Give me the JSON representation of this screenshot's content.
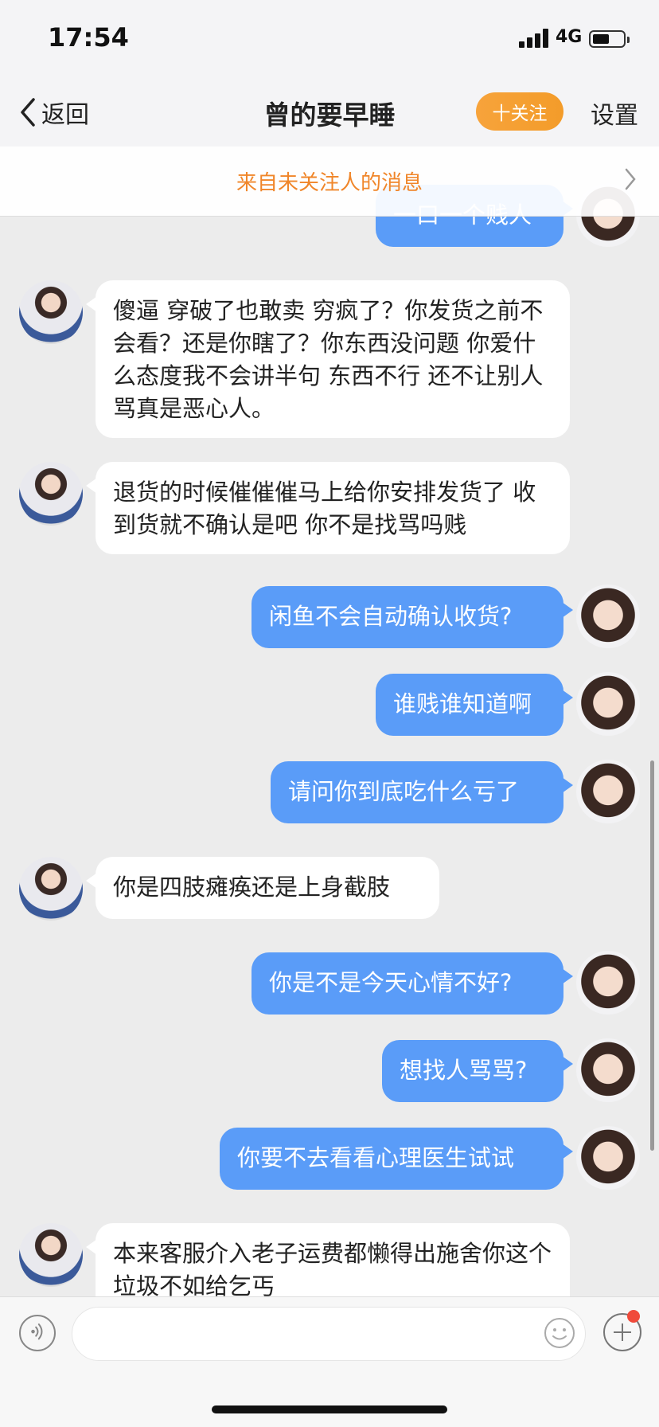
{
  "status": {
    "time": "17:54",
    "network": "4G"
  },
  "nav": {
    "back_label": "返回",
    "title": "曾的要早睡",
    "follow_label": "十关注",
    "settings_label": "设置"
  },
  "notice": {
    "text": "来自未关注人的消息"
  },
  "messages": [
    {
      "side": "out",
      "text": "一口一个贱人"
    },
    {
      "side": "in",
      "text": "傻逼 穿破了也敢卖 穷疯了？你发货之前不会看？还是你瞎了？你东西没问题 你爱什么态度我不会讲半句 东西不行 还不让别人骂真是恶心人。"
    },
    {
      "side": "in",
      "text": "退货的时候催催催马上给你安排发货了 收到货就不确认是吧 你不是找骂吗贱"
    },
    {
      "side": "out",
      "text": "闲鱼不会自动确认收货?"
    },
    {
      "side": "out",
      "text": "谁贱谁知道啊"
    },
    {
      "side": "out",
      "text": "请问你到底吃什么亏了"
    },
    {
      "side": "in",
      "text": "你是四肢瘫痪还是上身截肢"
    },
    {
      "side": "out",
      "text": "你是不是今天心情不好?"
    },
    {
      "side": "out",
      "text": "想找人骂骂?"
    },
    {
      "side": "out",
      "text": "你要不去看看心理医生试试"
    },
    {
      "side": "in",
      "text": "本来客服介入老子运费都懒得出施舍你这个垃圾不如给乞丐"
    }
  ],
  "icons": {
    "back": "chevron-left-icon",
    "notice": "chevron-right-icon",
    "voice": "voice-icon",
    "emoji": "emoji-icon",
    "add": "plus-icon"
  },
  "colors": {
    "outgoing_bubble": "#5a9cf8",
    "follow_button": "#f39c2a",
    "notice_text": "#f0862a"
  }
}
